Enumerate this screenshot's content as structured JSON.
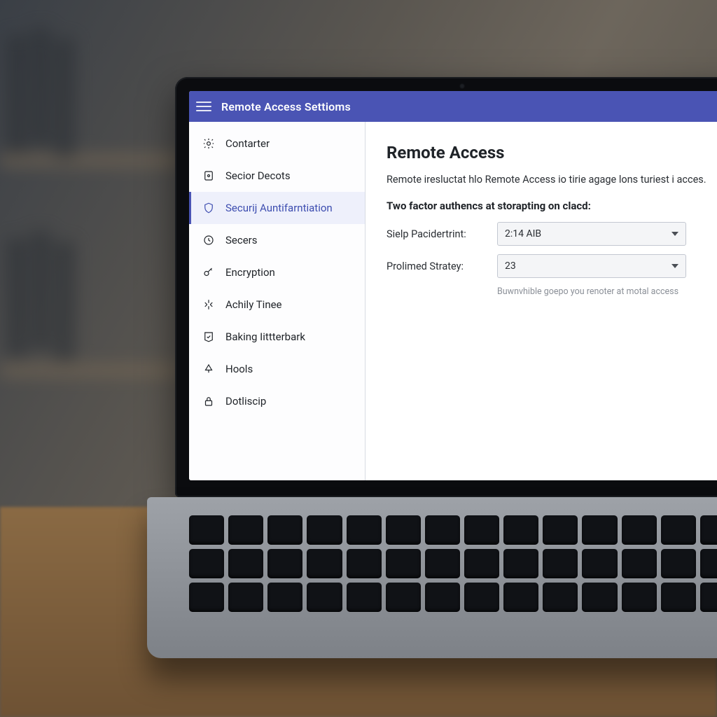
{
  "header": {
    "title": "Remote Access Settioms"
  },
  "sidebar": {
    "items": [
      {
        "label": "Contarter"
      },
      {
        "label": "Secior Decots"
      },
      {
        "label": "Securij Auntifarntiation"
      },
      {
        "label": "Secers"
      },
      {
        "label": "Encryption"
      },
      {
        "label": "Achily Tinee"
      },
      {
        "label": "Baking Iittterbark"
      },
      {
        "label": "Hools"
      },
      {
        "label": "Dotliscip"
      }
    ]
  },
  "main": {
    "heading": "Remote Access",
    "description": "Remote iresluctat hlo Remote Access io tirie agage lons turiest i acces.",
    "subheading": "Two factor authencs at storapting on clacd:",
    "fields": {
      "field1": {
        "label": "Sielp Pacidertrint:",
        "value": "2:14 AIB"
      },
      "field2": {
        "label": "Prolimed Stratey:",
        "value": "23"
      }
    },
    "hint": "Buwnvhible goepo you renoter at motal access"
  }
}
